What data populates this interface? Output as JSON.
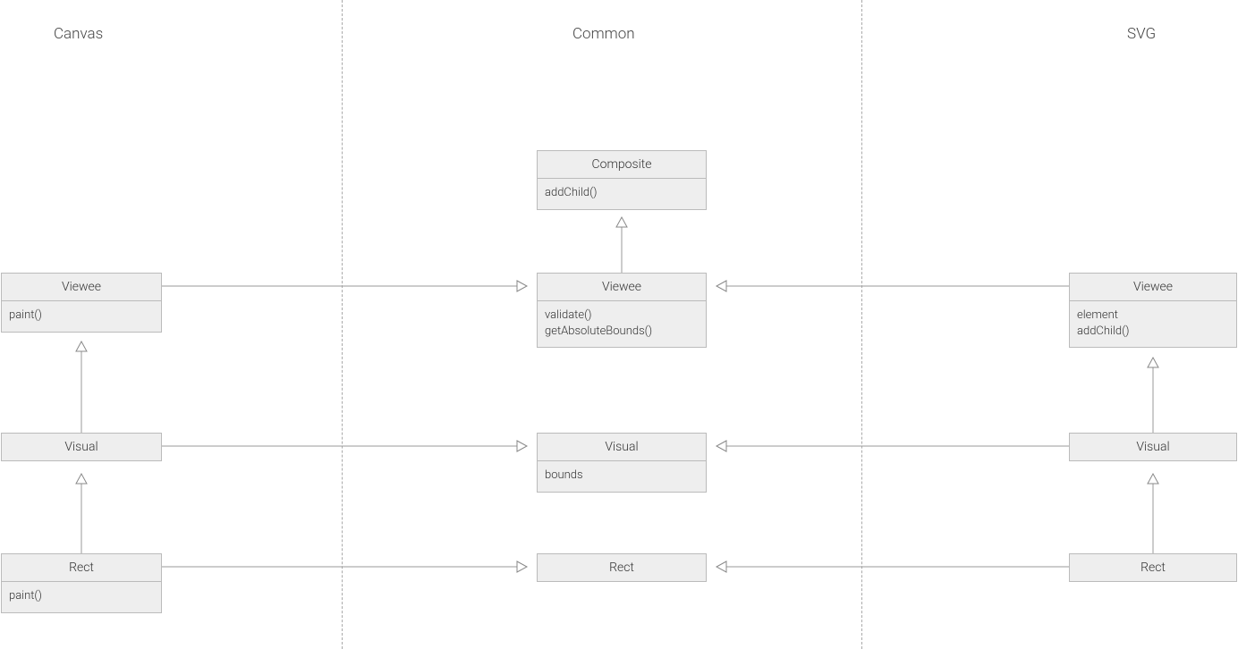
{
  "columns": {
    "canvas": {
      "title": "Canvas"
    },
    "common": {
      "title": "Common"
    },
    "svg": {
      "title": "SVG"
    }
  },
  "boxes": {
    "composite": {
      "title": "Composite",
      "members": [
        "addChild()"
      ]
    },
    "canvas_viewee": {
      "title": "Viewee",
      "members": [
        "paint()"
      ]
    },
    "common_viewee": {
      "title": "Viewee",
      "members": [
        "validate()",
        "getAbsoluteBounds()"
      ]
    },
    "svg_viewee": {
      "title": "Viewee",
      "members": [
        "element",
        "addChild()"
      ]
    },
    "canvas_visual": {
      "title": "Visual",
      "members": []
    },
    "common_visual": {
      "title": "Visual",
      "members": [
        "bounds"
      ]
    },
    "svg_visual": {
      "title": "Visual",
      "members": []
    },
    "canvas_rect": {
      "title": "Rect",
      "members": [
        "paint()"
      ]
    },
    "common_rect": {
      "title": "Rect",
      "members": []
    },
    "svg_rect": {
      "title": "Rect",
      "members": []
    }
  }
}
